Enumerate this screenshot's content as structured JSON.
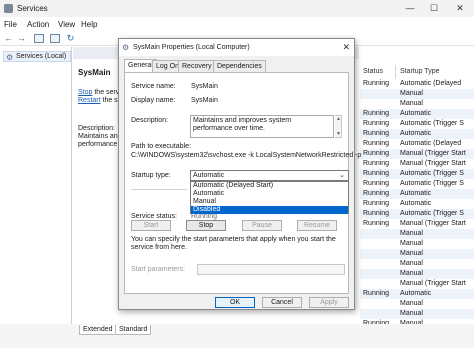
{
  "window": {
    "title": "Services",
    "controls": [
      "—",
      "☐",
      "✕"
    ]
  },
  "menu": [
    "File",
    "Action",
    "View",
    "Help"
  ],
  "tree": {
    "root_label": "Services (Local)"
  },
  "center": {
    "service_name": "SysMain",
    "stop_link": "Stop",
    "stop_rest": " the service",
    "restart_link": "Restart",
    "restart_rest": " the service",
    "desc_label": "Description:",
    "desc_line1": "Maintains an",
    "desc_line2": "performance"
  },
  "grid": {
    "col_status": "Status",
    "col_startup": "Startup Type",
    "rows": [
      {
        "status": "Running",
        "startup": "Automatic (Delayed"
      },
      {
        "status": "",
        "startup": "Manual"
      },
      {
        "status": "",
        "startup": "Manual"
      },
      {
        "status": "Running",
        "startup": "Automatic"
      },
      {
        "status": "Running",
        "startup": "Automatic (Trigger S"
      },
      {
        "status": "Running",
        "startup": "Automatic"
      },
      {
        "status": "Running",
        "startup": "Automatic (Delayed"
      },
      {
        "status": "Running",
        "startup": "Manual (Trigger Start"
      },
      {
        "status": "Running",
        "startup": "Manual (Trigger Start"
      },
      {
        "status": "Running",
        "startup": "Automatic (Trigger S"
      },
      {
        "status": "Running",
        "startup": "Automatic (Trigger S"
      },
      {
        "status": "Running",
        "startup": "Automatic"
      },
      {
        "status": "Running",
        "startup": "Automatic"
      },
      {
        "status": "Running",
        "startup": "Automatic (Trigger S"
      },
      {
        "status": "Running",
        "startup": "Manual (Trigger Start"
      },
      {
        "status": "",
        "startup": "Manual"
      },
      {
        "status": "",
        "startup": "Manual"
      },
      {
        "status": "",
        "startup": "Manual"
      },
      {
        "status": "",
        "startup": "Manual"
      },
      {
        "status": "",
        "startup": "Manual"
      },
      {
        "status": "",
        "startup": "Manual (Trigger Start"
      },
      {
        "status": "Running",
        "startup": "Automatic"
      },
      {
        "status": "",
        "startup": "Manual"
      },
      {
        "status": "",
        "startup": "Manual"
      },
      {
        "status": "Running",
        "startup": "Manual"
      },
      {
        "status": "",
        "startup": "Manual"
      }
    ]
  },
  "bottom_tabs": [
    "Extended",
    "Standard"
  ],
  "dialog": {
    "title": "SysMain Properties (Local Computer)",
    "close_glyph": "✕",
    "tabs": [
      "General",
      "Log On",
      "Recovery",
      "Dependencies"
    ],
    "service_name_label": "Service name:",
    "service_name_value": "SysMain",
    "display_name_label": "Display name:",
    "display_name_value": "SysMain",
    "description_label": "Description:",
    "description_value": "Maintains and improves system performance over time.",
    "path_label": "Path to executable:",
    "path_value": "C:\\WINDOWS\\system32\\svchost.exe -k LocalSystemNetworkRestricted -p",
    "startup_type_label": "Startup type:",
    "startup_type_value": "Automatic",
    "startup_options": [
      "Automatic (Delayed Start)",
      "Automatic",
      "Manual",
      "Disabled"
    ],
    "startup_highlighted": "Disabled",
    "service_status_label": "Service status:",
    "service_status_value": "Running",
    "buttons": {
      "start": "Start",
      "stop": "Stop",
      "pause": "Pause",
      "resume": "Resume"
    },
    "hint": "You can specify the start parameters that apply when you start the service from here.",
    "start_params_label": "Start parameters:",
    "start_params_value": "",
    "footer": {
      "ok": "OK",
      "cancel": "Cancel",
      "apply": "Apply"
    }
  }
}
